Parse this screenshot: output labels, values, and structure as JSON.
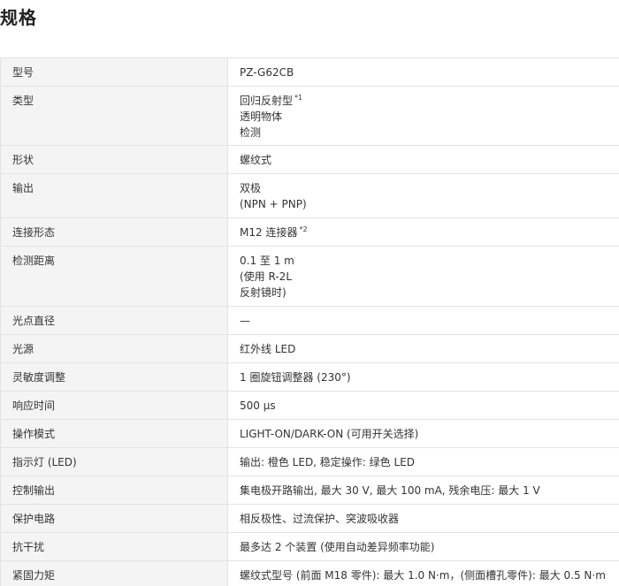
{
  "title": "规格",
  "rows": [
    {
      "label": "型号",
      "lines": [
        "PZ-G62CB"
      ]
    },
    {
      "label": "类型",
      "lines": [
        "回归反射型",
        "透明物体",
        "检测"
      ],
      "note": "*1"
    },
    {
      "label": "形状",
      "lines": [
        "螺纹式"
      ]
    },
    {
      "label": "输出",
      "lines": [
        "双极",
        "(NPN + PNP)"
      ]
    },
    {
      "label": "连接形态",
      "lines": [
        "M12 连接器"
      ],
      "note": "*2"
    },
    {
      "label": "检测距离",
      "lines": [
        "0.1 至 1 m",
        "(使用 R-2L",
        "反射镜时)"
      ]
    },
    {
      "label": "光点直径",
      "lines": [
        "—"
      ]
    },
    {
      "label": "光源",
      "lines": [
        "红外线 LED"
      ]
    },
    {
      "label": "灵敏度调整",
      "lines": [
        "1 圈旋钮调整器 (230°)"
      ]
    },
    {
      "label": "响应时间",
      "lines": [
        "500 µs"
      ]
    },
    {
      "label": "操作模式",
      "lines": [
        "LIGHT-ON/DARK-ON (可用开关选择)"
      ]
    },
    {
      "label": "指示灯 (LED)",
      "lines": [
        "输出: 橙色 LED, 稳定操作: 绿色 LED"
      ]
    },
    {
      "label": "控制输出",
      "lines": [
        "集电极开路输出, 最大 30 V, 最大 100 mA, 残余电压: 最大 1 V"
      ]
    },
    {
      "label": "保护电路",
      "lines": [
        "相反极性、过流保护、突波吸收器"
      ]
    },
    {
      "label": "抗干扰",
      "lines": [
        "最多达 2 个装置 (使用自动差异频率功能)"
      ]
    },
    {
      "label": "紧固力矩",
      "lines": [
        "螺纹式型号 (前面 M18 零件): 最大 1.0 N·m，(侧面槽孔零件): 最大 0.5 N·m"
      ]
    }
  ]
}
